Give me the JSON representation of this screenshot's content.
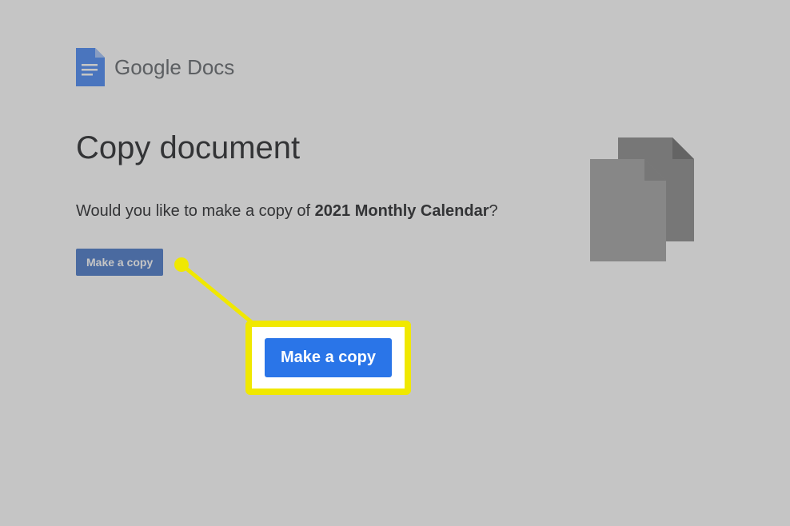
{
  "header": {
    "product_google": "Google",
    "product_docs": " Docs"
  },
  "page": {
    "title": "Copy document",
    "prompt_prefix": "Would you like to make a copy of ",
    "document_name": "2021 Monthly Calendar",
    "prompt_suffix": "?"
  },
  "buttons": {
    "make_copy": "Make a copy"
  },
  "callout": {
    "button_label": "Make a copy"
  }
}
